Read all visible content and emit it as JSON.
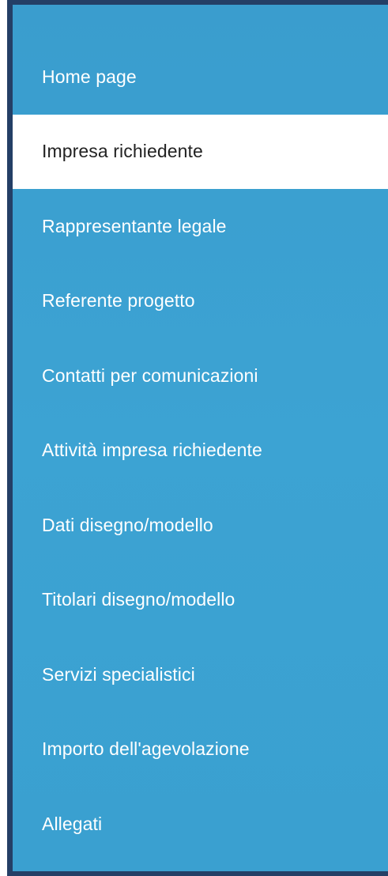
{
  "sidebar": {
    "active_index": 1,
    "items": [
      {
        "label": "Home page"
      },
      {
        "label": "Impresa richiedente"
      },
      {
        "label": "Rappresentante legale"
      },
      {
        "label": "Referente progetto"
      },
      {
        "label": "Contatti per comunicazioni"
      },
      {
        "label": "Attività impresa richiedente"
      },
      {
        "label": "Dati disegno/modello"
      },
      {
        "label": "Titolari disegno/modello"
      },
      {
        "label": "Servizi specialistici"
      },
      {
        "label": "Importo dell'agevolazione"
      },
      {
        "label": "Allegati"
      }
    ]
  },
  "colors": {
    "sidebar_bg": "#3ca3d3",
    "frame": "#243f66",
    "active_bg": "#ffffff",
    "active_text": "#222222",
    "text": "#ffffff"
  }
}
